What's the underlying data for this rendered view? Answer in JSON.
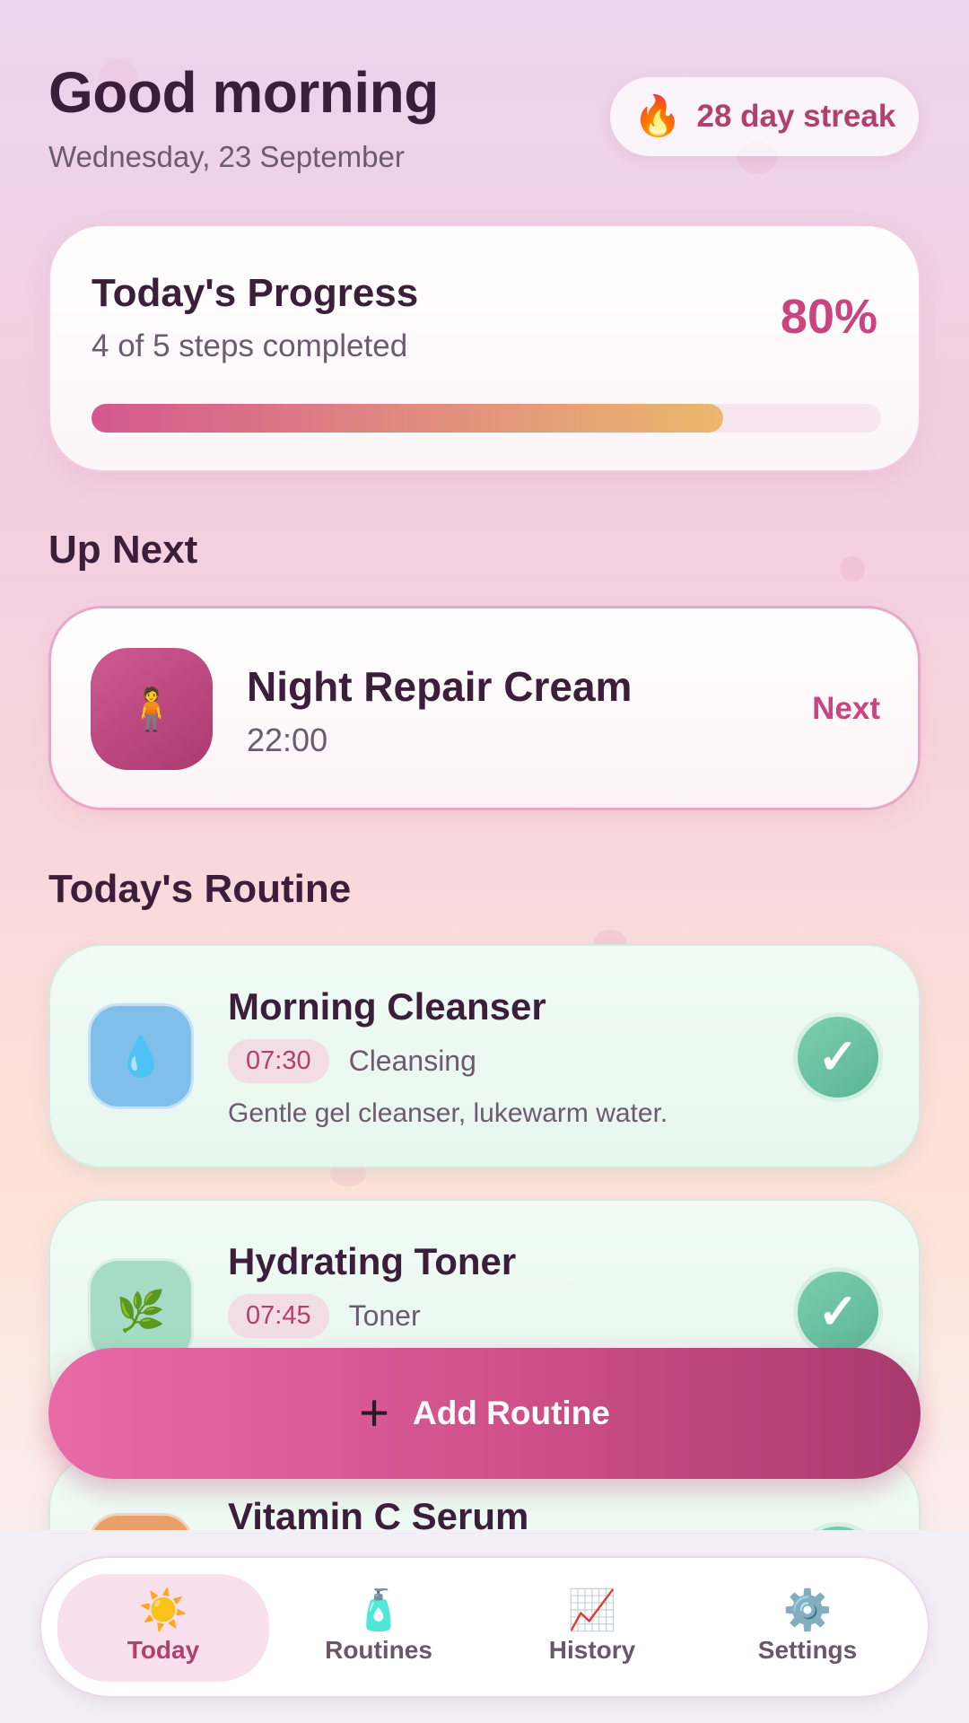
{
  "header": {
    "greeting": "Good morning",
    "date": "Wednesday, 23 September",
    "streak": {
      "icon": "🔥",
      "label": "28 day streak"
    }
  },
  "progress": {
    "title": "Today's Progress",
    "subtitle": "4 of 5 steps completed",
    "percent_label": "80%",
    "value": 0.8
  },
  "up_next": {
    "section_title": "Up Next",
    "icon": "🧍",
    "name": "Night Repair Cream",
    "time": "22:00",
    "action_label": "Next"
  },
  "routine": {
    "section_title": "Today's Routine",
    "items": [
      {
        "name": "Morning Cleanser",
        "time": "07:30",
        "category": "Cleansing",
        "description": "Gentle gel cleanser, lukewarm water.",
        "icon": "💧",
        "icon_color": "#7fbfea",
        "done": true
      },
      {
        "name": "Hydrating Toner",
        "time": "07:45",
        "category": "Toner",
        "description": "",
        "icon": "🌿",
        "icon_color": "#a6dcc6",
        "done": true
      },
      {
        "name": "Vitamin C Serum",
        "time": "",
        "category": "",
        "description": "",
        "icon": "",
        "icon_color": "#e8a06a",
        "done": true
      }
    ]
  },
  "fab": {
    "plus": "+",
    "label": "Add Routine"
  },
  "nav": {
    "items": [
      {
        "label": "Today",
        "icon": "☀️",
        "active": true
      },
      {
        "label": "Routines",
        "icon": "🧴",
        "active": false
      },
      {
        "label": "History",
        "icon": "📈",
        "active": false
      },
      {
        "label": "Settings",
        "icon": "⚙️",
        "active": false
      }
    ]
  },
  "colors": {
    "accent": "#c8457f",
    "done": "#5bb497"
  }
}
